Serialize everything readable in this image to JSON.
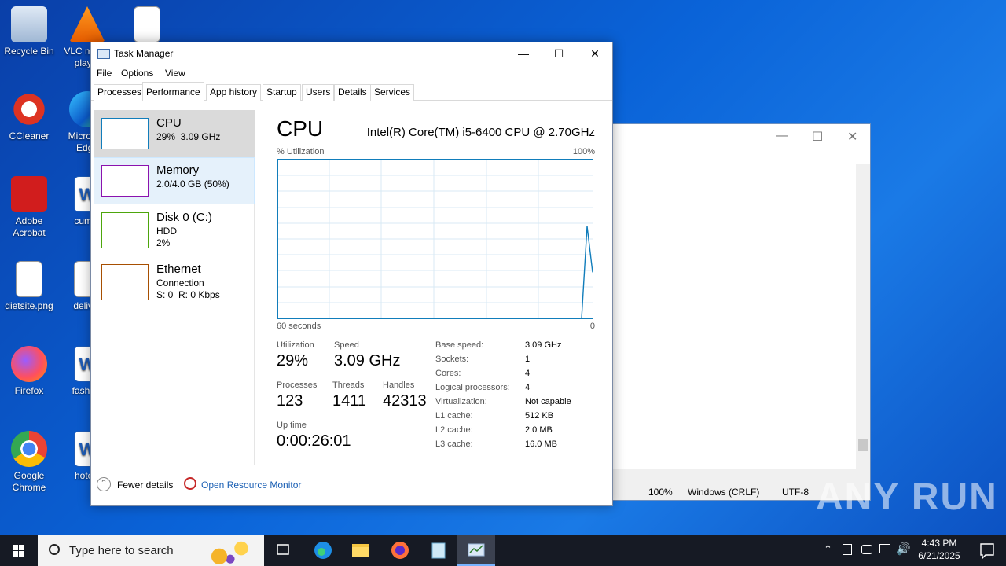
{
  "desktop_icons": [
    {
      "label": "Recycle Bin"
    },
    {
      "label": "VLC media player"
    },
    {
      "label": "CCleaner"
    },
    {
      "label": "Microsoft Edge"
    },
    {
      "label": "Adobe Acrobat"
    },
    {
      "label": "cumpr"
    },
    {
      "label": "dietsite.png"
    },
    {
      "label": "deliver"
    },
    {
      "label": "Firefox"
    },
    {
      "label": "fashion"
    },
    {
      "label": "Google Chrome"
    },
    {
      "label": "hotels"
    }
  ],
  "notepad": {
    "status_zoom": "100%",
    "status_eol": "Windows (CRLF)",
    "status_encoding": "UTF-8"
  },
  "taskmgr": {
    "title": "Task Manager",
    "menu": [
      "File",
      "Options",
      "View"
    ],
    "tabs": [
      "Processes",
      "Performance",
      "App history",
      "Startup",
      "Users",
      "Details",
      "Services"
    ],
    "sidebar": [
      {
        "name": "CPU",
        "l1": "29%  3.09 GHz",
        "l2": ""
      },
      {
        "name": "Memory",
        "l1": "2.0/4.0 GB (50%)",
        "l2": ""
      },
      {
        "name": "Disk 0 (C:)",
        "l1": "HDD",
        "l2": "2%"
      },
      {
        "name": "Ethernet",
        "l1": "Connection",
        "l2": "S: 0  R: 0 Kbps"
      }
    ],
    "cpu": {
      "heading": "CPU",
      "model": "Intel(R) Core(TM) i5-6400 CPU @ 2.70GHz",
      "util_label": "% Utilization",
      "max_label": "100%",
      "time_label": "60 seconds",
      "zero_label": "0",
      "stats": {
        "utilization_label": "Utilization",
        "utilization": "29%",
        "speed_label": "Speed",
        "speed": "3.09 GHz",
        "processes_label": "Processes",
        "processes": "123",
        "threads_label": "Threads",
        "threads": "1411",
        "handles_label": "Handles",
        "handles": "42313",
        "uptime_label": "Up time",
        "uptime": "0:00:26:01"
      },
      "specs": [
        {
          "k": "Base speed:",
          "v": "3.09 GHz"
        },
        {
          "k": "Sockets:",
          "v": "1"
        },
        {
          "k": "Cores:",
          "v": "4"
        },
        {
          "k": "Logical processors:",
          "v": "4"
        },
        {
          "k": "Virtualization:",
          "v": "Not capable"
        },
        {
          "k": "L1 cache:",
          "v": "512 KB"
        },
        {
          "k": "L2 cache:",
          "v": "2.0 MB"
        },
        {
          "k": "L3 cache:",
          "v": "16.0 MB"
        }
      ],
      "graph_values": [
        0,
        0,
        0,
        0,
        0,
        0,
        0,
        0,
        0,
        0,
        0,
        0,
        0,
        0,
        0,
        0,
        0,
        0,
        0,
        0,
        0,
        0,
        0,
        0,
        0,
        0,
        0,
        0,
        0,
        0,
        0,
        0,
        0,
        0,
        0,
        0,
        0,
        0,
        0,
        0,
        0,
        0,
        0,
        0,
        0,
        0,
        0,
        0,
        0,
        0,
        0,
        0,
        0,
        0,
        0,
        0,
        0,
        58,
        29
      ]
    },
    "fewer_details": "Fewer details",
    "open_resource_monitor": "Open Resource Monitor"
  },
  "taskbar": {
    "search_placeholder": "Type here to search",
    "time": "4:43 PM",
    "date": "6/21/2025"
  },
  "watermark": "ANY RUN"
}
